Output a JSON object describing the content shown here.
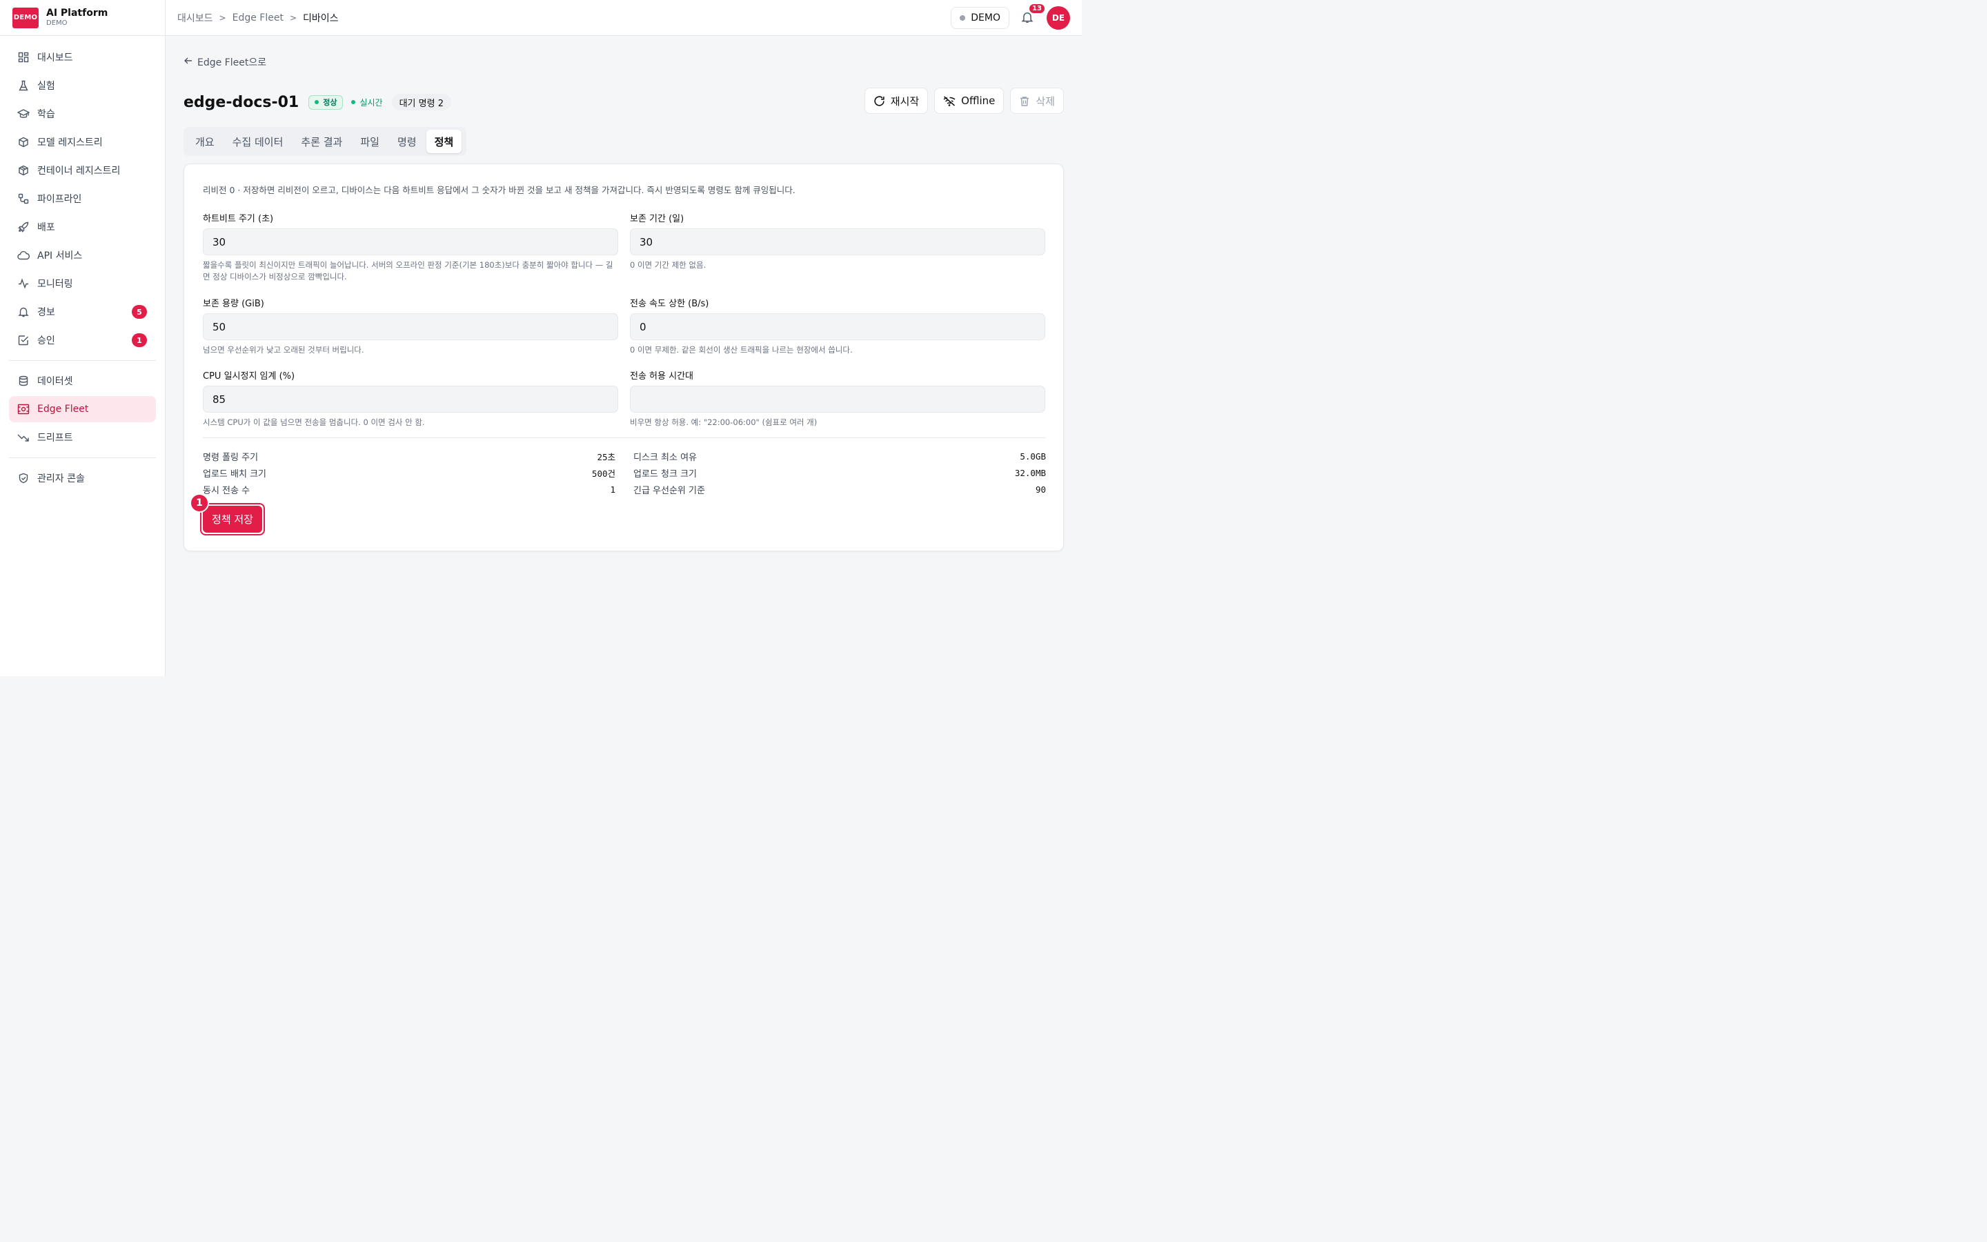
{
  "brand": {
    "logo": "DEMO",
    "title": "AI Platform",
    "subtitle": "DEMO"
  },
  "sidebar": {
    "items": [
      {
        "label": "대시보드",
        "icon": "dashboard-icon"
      },
      {
        "label": "실험",
        "icon": "flask-icon"
      },
      {
        "label": "학습",
        "icon": "graduation-cap-icon"
      },
      {
        "label": "모델 레지스트리",
        "icon": "cube-icon"
      },
      {
        "label": "컨테이너 레지스트리",
        "icon": "package-icon"
      },
      {
        "label": "파이프라인",
        "icon": "workflow-icon"
      },
      {
        "label": "배포",
        "icon": "rocket-icon"
      },
      {
        "label": "API 서비스",
        "icon": "cloud-icon"
      },
      {
        "label": "모니터링",
        "icon": "activity-icon"
      },
      {
        "label": "경보",
        "icon": "bell-icon",
        "badge": "5"
      },
      {
        "label": "승인",
        "icon": "check-square-icon",
        "badge": "1"
      }
    ],
    "items2": [
      {
        "label": "데이터셋",
        "icon": "database-icon"
      },
      {
        "label": "Edge Fleet",
        "icon": "router-icon",
        "active": true
      },
      {
        "label": "드리프트",
        "icon": "trending-down-icon"
      }
    ],
    "items3": [
      {
        "label": "관리자 콘솔",
        "icon": "shield-icon"
      }
    ]
  },
  "topbar": {
    "breadcrumb": [
      "대시보드",
      "Edge Fleet",
      "디바이스"
    ],
    "env_label": "DEMO",
    "notifications": "13",
    "avatar": "DE"
  },
  "page": {
    "back_label": "Edge Fleet으로",
    "device_name": "edge-docs-01",
    "status": "정상",
    "live": "실시간",
    "pending": "대기 명령 2",
    "actions": {
      "restart": "재시작",
      "offline": "Offline",
      "delete": "삭제"
    },
    "tabs": [
      "개요",
      "수집 데이터",
      "추론 결과",
      "파일",
      "명령",
      "정책"
    ],
    "active_tab": "정책"
  },
  "policy": {
    "revision_text": "리비전 0 · 저장하면 리비전이 오르고, 디바이스는 다음 하트비트 응답에서 그 숫자가 바뀐 것을 보고 새 정책을 가져갑니다. 즉시 반영되도록 명령도 함께 큐잉됩니다.",
    "fields": {
      "heartbeat": {
        "label": "하트비트 주기 (초)",
        "value": "30",
        "help": "짧을수록 플릿이 최신이지만 트래픽이 늘어납니다. 서버의 오프라인 판정 기준(기본 180초)보다 충분히 짧아야 합니다 — 길면 정상 디바이스가 비정상으로 깜빡입니다."
      },
      "retention_days": {
        "label": "보존 기간 (일)",
        "value": "30",
        "help": "0 이면 기간 제한 없음."
      },
      "retention_gib": {
        "label": "보존 용량 (GiB)",
        "value": "50",
        "help": "넘으면 우선순위가 낮고 오래된 것부터 버립니다."
      },
      "rate_limit": {
        "label": "전송 속도 상한 (B/s)",
        "value": "0",
        "help": "0 이면 무제한. 같은 회선이 생산 트래픽을 나르는 현장에서 씁니다."
      },
      "cpu_pause": {
        "label": "CPU 일시정지 임계 (%)",
        "value": "85",
        "help": "시스템 CPU가 이 값을 넘으면 전송을 멈춥니다. 0 이면 검사 안 함."
      },
      "window": {
        "label": "전송 허용 시간대",
        "value": "",
        "help": "비우면 항상 허용. 예: \"22:00-06:00\" (쉼표로 여러 개)"
      }
    },
    "stats_left": [
      {
        "label": "명령 폴링 주기",
        "value": "25초"
      },
      {
        "label": "업로드 배치 크기",
        "value": "500건"
      },
      {
        "label": "동시 전송 수",
        "value": "1"
      }
    ],
    "stats_right": [
      {
        "label": "디스크 최소 여유",
        "value": "5.0GB"
      },
      {
        "label": "업로드 청크 크기",
        "value": "32.0MB"
      },
      {
        "label": "긴급 우선순위 기준",
        "value": "90"
      }
    ],
    "save_label": "정책 저장",
    "marker": "1"
  },
  "colors": {
    "accent": "#e11d48",
    "success": "#10b981"
  }
}
